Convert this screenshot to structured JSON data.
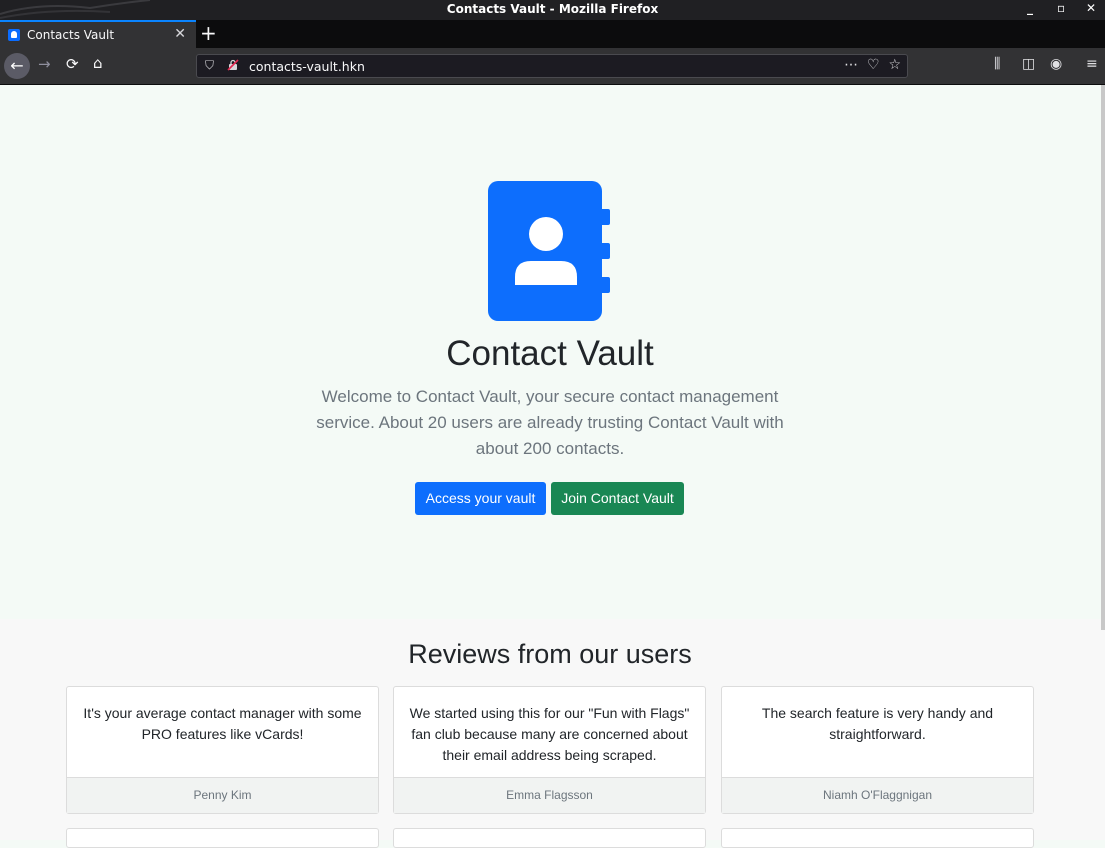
{
  "window": {
    "title": "Contacts Vault - Mozilla Firefox"
  },
  "browser": {
    "tab_title": "Contacts Vault",
    "url": "contacts-vault.hkn"
  },
  "hero": {
    "title": "Contact Vault",
    "text": "Welcome to Contact Vault, your secure contact management service. About 20 users are already trusting Contact Vault with about 200 contacts.",
    "primary_button": "Access your vault",
    "secondary_button": "Join Contact Vault",
    "accent_color": "#0d6efd",
    "success_color": "#198754"
  },
  "reviews": {
    "title": "Reviews from our users",
    "items": [
      {
        "text": "It's your average contact manager with some PRO features like vCards!",
        "author": "Penny Kim"
      },
      {
        "text": "We started using this for our \"Fun with Flags\" fan club because many are concerned about their email address being scraped.",
        "author": "Emma Flagsson"
      },
      {
        "text": "The search feature is very handy and straightforward.",
        "author": "Niamh O'Flaggnigan"
      }
    ]
  }
}
